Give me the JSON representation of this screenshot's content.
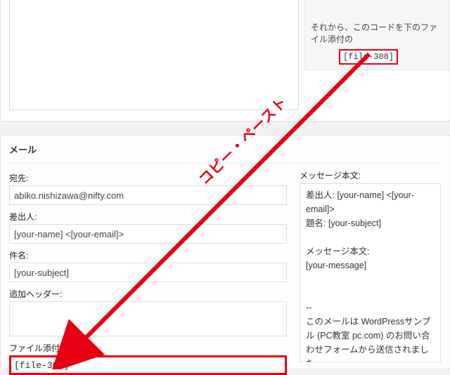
{
  "upper": {
    "textarea_value": "",
    "tip_text": "それから、このコードを下のファイル添付の",
    "tip_code": "[file-308]"
  },
  "mail": {
    "heading": "メール",
    "to_label": "宛先:",
    "to_value": "abiko.nishizawa@nifty.com",
    "from_label": "差出人:",
    "from_value": "[your-name] <[your-email]>",
    "subject_label": "件名:",
    "subject_value": "[your-subject]",
    "additional_headers_label": "追加ヘッダー:",
    "additional_headers_value": "",
    "file_attach_label": "ファイル添付:",
    "file_attach_value": "[file-308]",
    "msgbody_label": "メッセージ本文:",
    "msgbody_value": "差出人: [your-name] <[your-email]>\n題名: [your-subject]\n\nメッセージ本文:\n[your-message]\n\n\n--\nこのメールは WordPressサンプル (PC教室 pc.com) のお問い合わせフォームから送信されました"
  },
  "annotation": {
    "label": "コピー・ペースト"
  }
}
